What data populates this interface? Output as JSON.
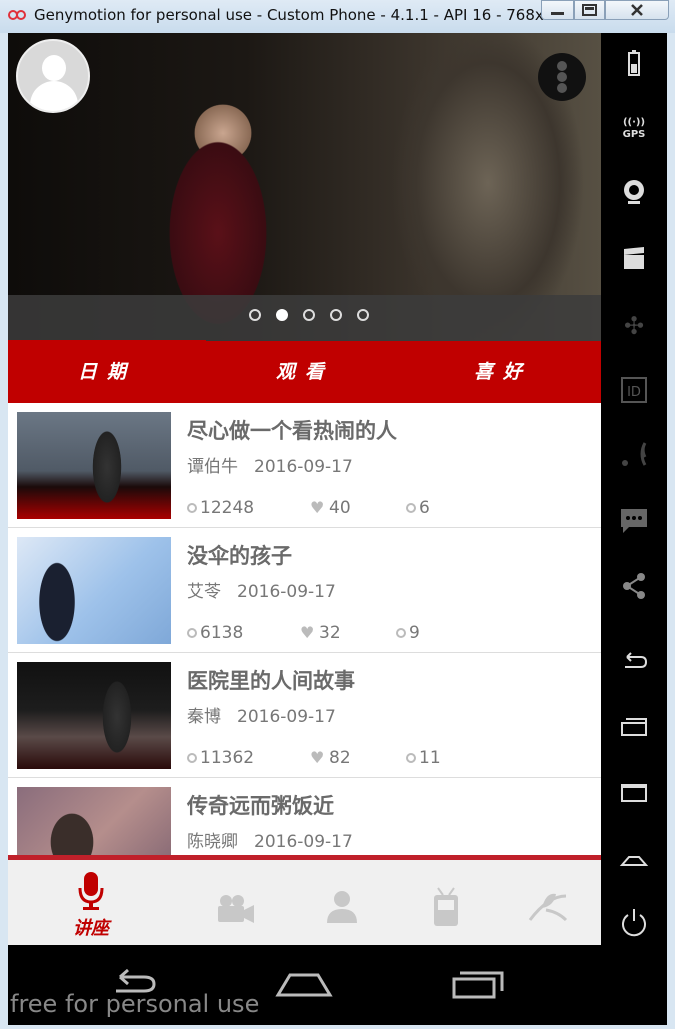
{
  "window": {
    "title": "Genymotion for personal use - Custom Phone - 4.1.1 - API 16 - 768x..."
  },
  "tabs": [
    "日期",
    "观看",
    "喜好"
  ],
  "list": [
    {
      "title": "尽心做一个看热闹的人",
      "speaker": "谭伯牛",
      "date": "2016-09-17",
      "views": "12248",
      "likes": "40",
      "comments": "6"
    },
    {
      "title": "没伞的孩子",
      "speaker": "艾苓",
      "date": "2016-09-17",
      "views": "6138",
      "likes": "32",
      "comments": "9"
    },
    {
      "title": "医院里的人间故事",
      "speaker": "秦博",
      "date": "2016-09-17",
      "views": "11362",
      "likes": "82",
      "comments": "11"
    },
    {
      "title": "传奇远而粥饭近",
      "speaker": "陈晓卿",
      "date": "2016-09-17"
    }
  ],
  "bottom_nav": {
    "active_label": "讲座",
    "items": [
      "mic-icon",
      "video-camera-icon",
      "person-icon",
      "radio-icon",
      "leaf-icon"
    ]
  },
  "colors": {
    "accent": "#c00000",
    "list_text": "#6a6a6a"
  },
  "watermark": "free for personal use"
}
